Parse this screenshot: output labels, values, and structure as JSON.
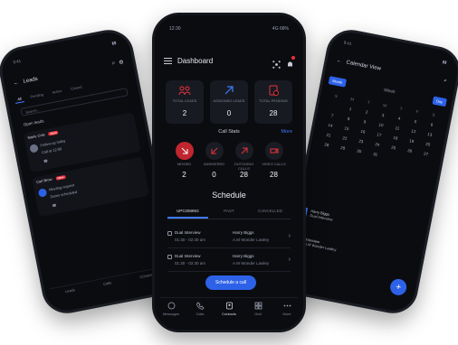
{
  "left_phone": {
    "status_time": "9:41",
    "title": "Leads",
    "tabs": [
      "All",
      "Pending",
      "Active",
      "Closed"
    ],
    "search_placeholder": "Search...",
    "section_label": "Open leads",
    "cards": [
      {
        "name": "Marie Cole",
        "badge": "New",
        "meta": "Follow-up today",
        "detail": "Call at 12:00"
      },
      {
        "name": "Carl Brow",
        "badge": "New",
        "meta": "Meeting request",
        "detail": "Demo scheduled"
      }
    ],
    "nav": [
      "Leads",
      "Calls",
      "Contacts"
    ]
  },
  "center_phone": {
    "status_time": "12:30",
    "status_right": "4G 68%",
    "title": "Dashboard",
    "stats": [
      {
        "label": "TOTAL LEADS",
        "value": "2"
      },
      {
        "label": "ASSIGNED LEADS",
        "value": "0"
      },
      {
        "label": "TOTAL PENDING",
        "value": "28"
      }
    ],
    "call_stats": {
      "title": "Call Stats",
      "more": "More",
      "items": [
        {
          "label": "MISSED",
          "value": "2",
          "color": "#e8323b"
        },
        {
          "label": "ANSWERED",
          "value": "0",
          "color": "#e8323b"
        },
        {
          "label": "OUTGOING CALLS",
          "value": "28",
          "color": "#e8323b"
        },
        {
          "label": "VIDEO CALLS",
          "value": "28",
          "color": "#e8323b"
        }
      ]
    },
    "schedule": {
      "title": "Schedule",
      "tabs": [
        "UPCOMING",
        "PAST",
        "CANCELLED"
      ],
      "active_tab": "UPCOMING",
      "items": [
        {
          "name": "Dual Interview",
          "time": "01:30 - 02:30 am",
          "person": "Harry Biggs",
          "place": "A.M Wonder Lawley"
        },
        {
          "name": "Dual Interview",
          "time": "01:30 - 02:30 am",
          "person": "Harry Biggs",
          "place": "A.M Wonder Lawley"
        }
      ],
      "button_label": "Schedule a call"
    },
    "nav": [
      "Messages",
      "Calls",
      "Contacts",
      "Grid",
      "More"
    ]
  },
  "right_phone": {
    "status_time": "9:41",
    "title": "Calendar View",
    "header_buttons": [
      "Month",
      "Week",
      "Day"
    ],
    "weekdays": [
      "S",
      "M",
      "T",
      "W",
      "T",
      "F",
      "S"
    ],
    "days": [
      "",
      "1",
      "2",
      "3",
      "4",
      "5",
      "6",
      "7",
      "8",
      "9",
      "10",
      "11",
      "12",
      "13",
      "14",
      "15",
      "16",
      "17",
      "18",
      "19",
      "20",
      "21",
      "22",
      "23",
      "24",
      "25",
      "26",
      "27",
      "28",
      "29",
      "30",
      "31",
      "",
      "",
      ""
    ],
    "events": [
      {
        "title": "Harry Biggs",
        "subtitle": "Dual Interview"
      },
      {
        "title": "Interview",
        "subtitle": "A.M Wonder Lawley"
      }
    ],
    "fab_label": "+"
  },
  "colors": {
    "accent": "#2d62e8",
    "danger": "#e8323b",
    "bg": "#0b0c10"
  }
}
